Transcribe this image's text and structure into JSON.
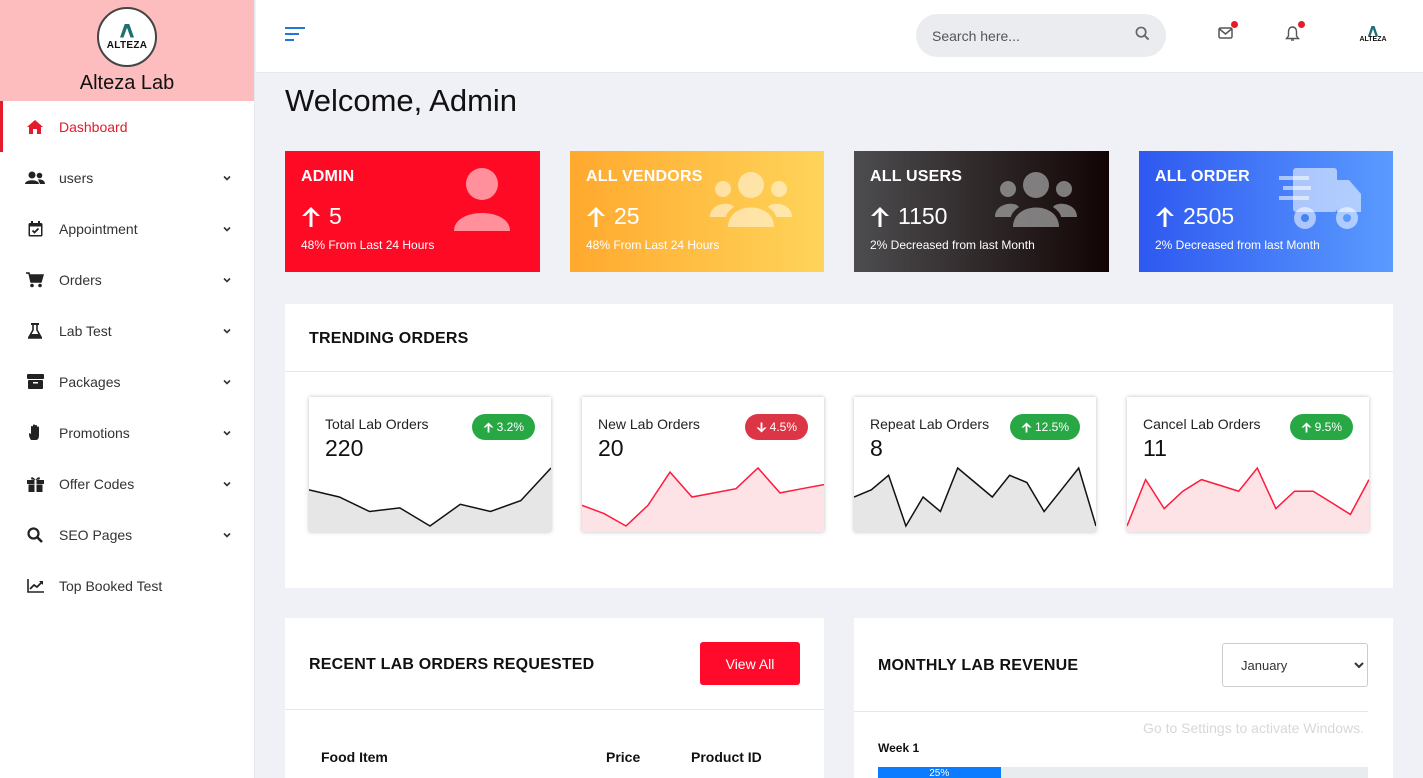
{
  "brand": {
    "logo_text": "ALTEZA",
    "name": "Alteza Lab"
  },
  "sidebar": {
    "items": [
      {
        "label": "Dashboard",
        "icon": "home-icon",
        "active": true
      },
      {
        "label": "users",
        "icon": "users-icon"
      },
      {
        "label": "Appointment",
        "icon": "calendar-check-icon"
      },
      {
        "label": "Orders",
        "icon": "cart-icon"
      },
      {
        "label": "Lab Test",
        "icon": "flask-icon"
      },
      {
        "label": "Packages",
        "icon": "box-icon"
      },
      {
        "label": "Promotions",
        "icon": "hand-icon"
      },
      {
        "label": "Offer Codes",
        "icon": "gift-icon"
      },
      {
        "label": "SEO Pages",
        "icon": "search-icon"
      },
      {
        "label": "Top Booked Test",
        "icon": "chart-line-icon"
      }
    ]
  },
  "header": {
    "search_placeholder": "Search here...",
    "logo_text": "ALTEZA"
  },
  "welcome": "Welcome, Admin",
  "stats": [
    {
      "title": "ADMIN",
      "value": "5",
      "sub": "48% From Last 24 Hours",
      "icon": "user-icon"
    },
    {
      "title": "ALL VENDORS",
      "value": "25",
      "sub": "48% From Last 24 Hours",
      "icon": "users-group-icon"
    },
    {
      "title": "ALL USERS",
      "value": "1150",
      "sub": "2% Decreased from last Month",
      "icon": "users-group-icon"
    },
    {
      "title": "ALL ORDER",
      "value": "2505",
      "sub": "2% Decreased from last Month",
      "icon": "truck-icon"
    }
  ],
  "trending": {
    "title": "TRENDING ORDERS",
    "cards": [
      {
        "label": "Total Lab Orders",
        "value": "220",
        "badge": "3.2%",
        "trend": "up",
        "series": [
          6,
          5,
          3,
          3.5,
          1,
          4,
          3,
          4.5,
          9
        ]
      },
      {
        "label": "New Lab Orders",
        "value": "20",
        "badge": "4.5%",
        "trend": "down",
        "series": [
          3,
          2,
          0.5,
          3,
          7,
          4,
          4.5,
          5,
          7.5,
          4.5,
          5,
          5.5
        ]
      },
      {
        "label": "Repeat Lab Orders",
        "value": "8",
        "badge": "12.5%",
        "trend": "up",
        "series": [
          5,
          6,
          8,
          1,
          5,
          3,
          9,
          7,
          5,
          8,
          7,
          3,
          6,
          9,
          1
        ]
      },
      {
        "label": "Cancel Lab Orders",
        "value": "11",
        "badge": "9.5%",
        "trend": "up",
        "series": [
          1,
          9,
          4,
          7,
          9,
          8,
          7,
          11,
          4,
          7,
          7,
          5,
          3,
          9
        ]
      }
    ]
  },
  "recent": {
    "title": "RECENT LAB ORDERS REQUESTED",
    "button": "View All",
    "columns": [
      "Food Item",
      "Price",
      "Product ID"
    ]
  },
  "revenue": {
    "title": "MONTHLY LAB REVENUE",
    "month": "January",
    "week_label": "Week 1",
    "progress_text": "25%",
    "progress": 0.25
  },
  "watermark": "Go to Settings to activate Windows.",
  "colors": {
    "accent": "#e31b2b",
    "up": "#28a745",
    "down": "#dc3545",
    "progress": "#0b7bff"
  }
}
